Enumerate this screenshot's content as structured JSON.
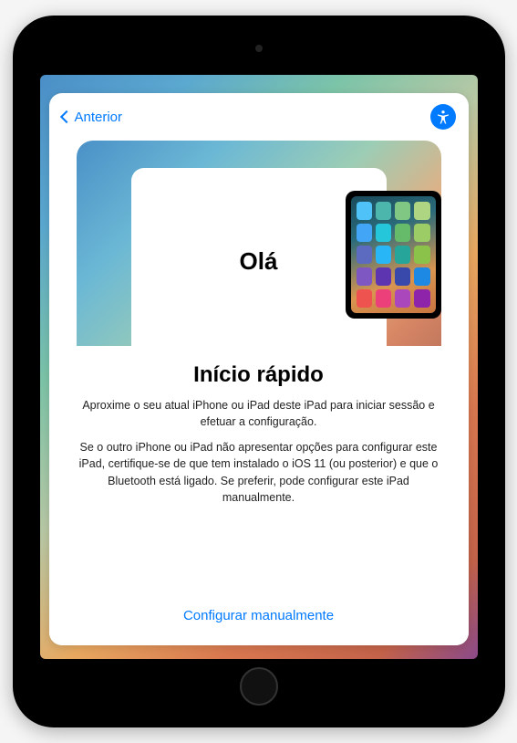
{
  "nav": {
    "back_label": "Anterior"
  },
  "hero": {
    "greeting": "Olá"
  },
  "content": {
    "title": "Início rápido",
    "description_1": "Aproxime o seu atual iPhone ou iPad deste iPad para iniciar sessão e efetuar a configuração.",
    "description_2": "Se o outro iPhone ou iPad não apresentar opções para configurar este iPad, certifique-se de que tem instalado o iOS 11 (ou posterior) e que o Bluetooth está ligado. Se preferir, pode configurar este iPad manualmente."
  },
  "actions": {
    "manual_setup_label": "Configurar manualmente"
  },
  "mini_app_colors": [
    "#4fc3f7",
    "#4db6ac",
    "#81c784",
    "#aed581",
    "#42a5f5",
    "#26c6da",
    "#66bb6a",
    "#9ccc65",
    "#5c6bc0",
    "#29b6f6",
    "#26a69a",
    "#8bc34a",
    "#7e57c2",
    "#5e35b1",
    "#3949ab",
    "#1e88e5",
    "#ef5350",
    "#ec407a",
    "#ab47bc",
    "#8e24aa"
  ]
}
